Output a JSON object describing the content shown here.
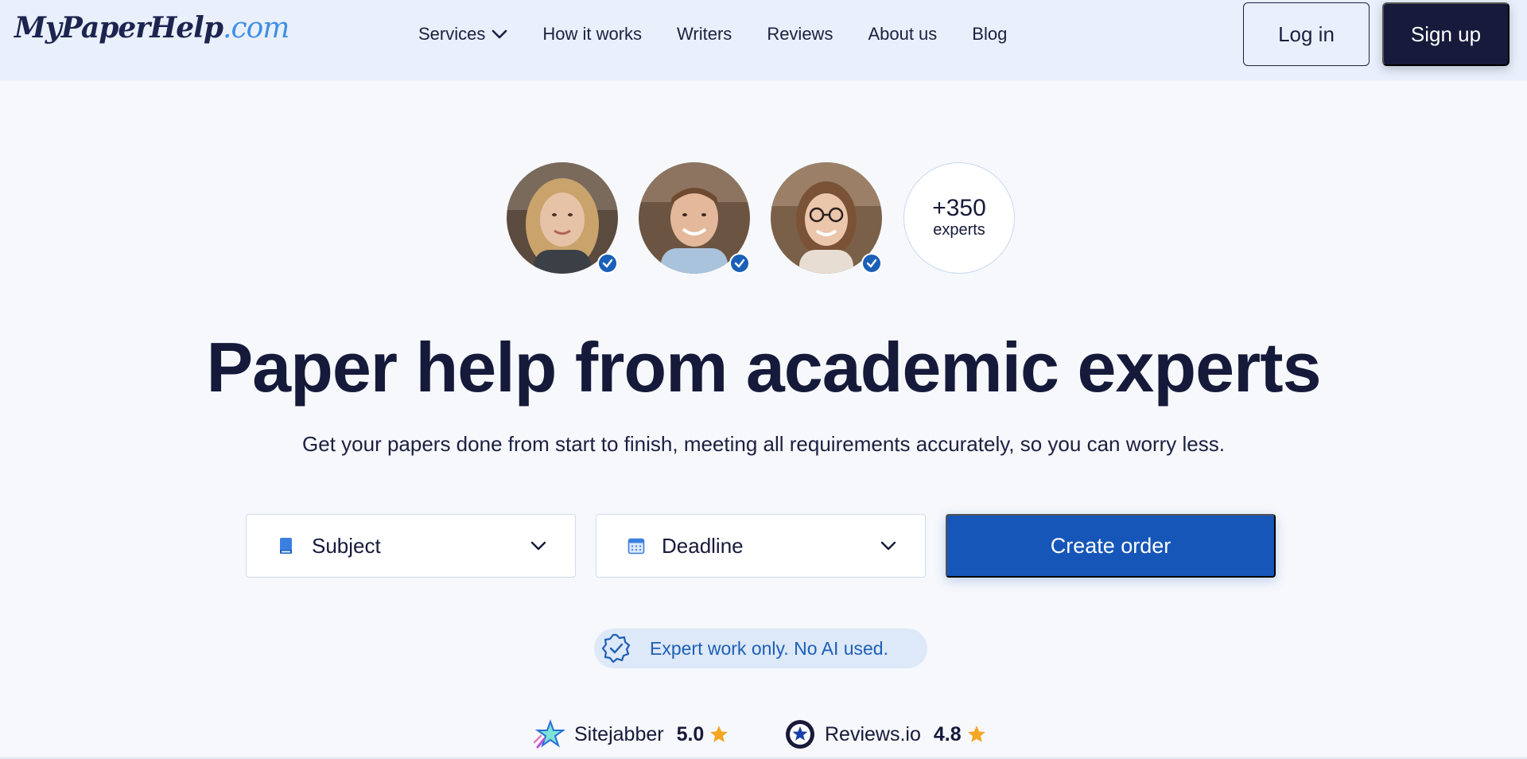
{
  "header": {
    "logo": {
      "main": "MyPaperHelp",
      "tld": ".com"
    },
    "nav": [
      {
        "label": "Services",
        "has_dropdown": true
      },
      {
        "label": "How it works"
      },
      {
        "label": "Writers"
      },
      {
        "label": "Reviews"
      },
      {
        "label": "About us"
      },
      {
        "label": "Blog"
      }
    ],
    "login_label": "Log in",
    "signup_label": "Sign up"
  },
  "experts": {
    "count": "+350",
    "label": "experts",
    "avatar_icons": [
      "verified-icon",
      "verified-icon",
      "verified-icon"
    ]
  },
  "hero": {
    "title": "Paper help from academic experts",
    "subtitle": "Get your papers done from start to finish, meeting all requirements accurately, so you can worry less."
  },
  "order_form": {
    "subject": {
      "label": "Subject",
      "icon": "book-icon"
    },
    "deadline": {
      "label": "Deadline",
      "icon": "calendar-icon"
    },
    "submit_label": "Create order"
  },
  "badge": {
    "icon": "shield-check-icon",
    "text": "Expert work only. No AI used."
  },
  "ratings": [
    {
      "name": "Sitejabber",
      "score": "5.0",
      "icon": "sitejabber-icon"
    },
    {
      "name": "Reviews.io",
      "score": "4.8",
      "icon": "reviews-io-icon"
    }
  ],
  "colors": {
    "primary": "#1656b8",
    "dark": "#171a3a",
    "header_bg": "#e9f0fb",
    "page_bg": "#f6f8fc",
    "star": "#f5a623"
  }
}
